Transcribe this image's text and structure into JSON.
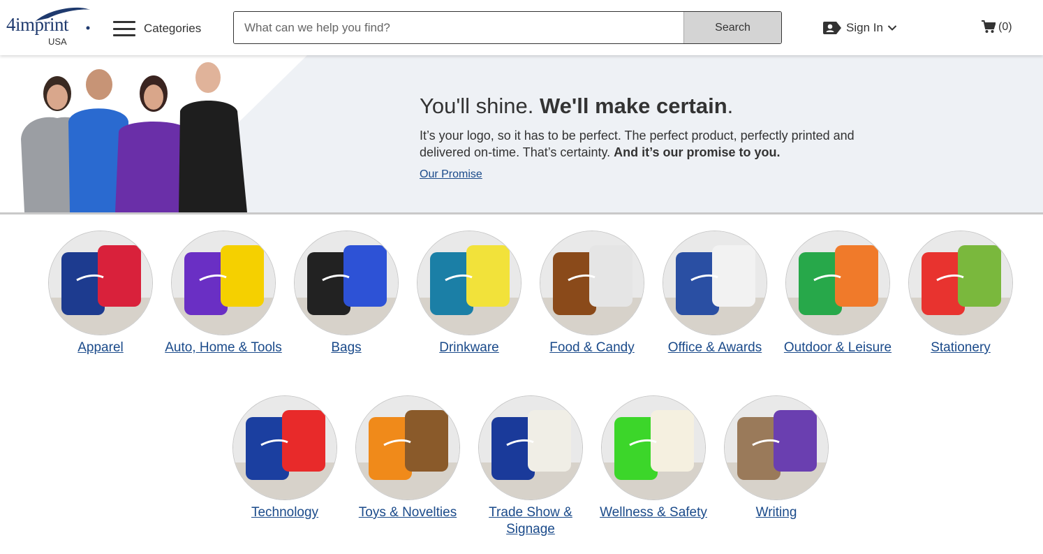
{
  "header": {
    "logo_text": "4imprint",
    "logo_region": "USA",
    "menu_label": "Categories",
    "search_placeholder": "What can we help you find?",
    "search_value": "",
    "search_button": "Search",
    "signin_label": "Sign In",
    "cart_count": "(0)"
  },
  "hero": {
    "title_light": "You'll shine. ",
    "title_bold": "We'll make certain",
    "title_end": ".",
    "body_regular": "It’s your logo, so it has to be perfect. The perfect product, perfectly printed and delivered on-time. That’s certainty. ",
    "body_bold": "And it’s our promise to you.",
    "link": "Our Promise"
  },
  "categories": [
    {
      "label": "Apparel",
      "icon": "apparel-image",
      "colors": [
        "#1d3b8f",
        "#d9213b"
      ]
    },
    {
      "label": "Auto, Home & Tools",
      "icon": "tools-image",
      "colors": [
        "#6a2fc4",
        "#f5d000"
      ]
    },
    {
      "label": "Bags",
      "icon": "bags-image",
      "colors": [
        "#222222",
        "#2d52d6"
      ]
    },
    {
      "label": "Drinkware",
      "icon": "drinkware-image",
      "colors": [
        "#1b7fa6",
        "#f2e23a"
      ]
    },
    {
      "label": "Food & Candy",
      "icon": "candy-image",
      "colors": [
        "#8a4a1a",
        "#e5e5e5"
      ]
    },
    {
      "label": "Office & Awards",
      "icon": "awards-image",
      "colors": [
        "#2a4fa3",
        "#f2f2f2"
      ]
    },
    {
      "label": "Outdoor & Leisure",
      "icon": "outdoor-image",
      "colors": [
        "#27a84a",
        "#f07a2a"
      ]
    },
    {
      "label": "Stationery",
      "icon": "stationery-image",
      "colors": [
        "#e8332f",
        "#7ab83d"
      ]
    },
    {
      "label": "Technology",
      "icon": "technology-image",
      "colors": [
        "#1b3fa0",
        "#e82a2a"
      ]
    },
    {
      "label": "Toys & Novelties",
      "icon": "toys-image",
      "colors": [
        "#f08a1a",
        "#8a5a2a"
      ]
    },
    {
      "label": "Trade Show & Signage",
      "icon": "tradeshow-image",
      "colors": [
        "#1a3a9a",
        "#f0eee6"
      ]
    },
    {
      "label": "Wellness & Safety",
      "icon": "wellness-image",
      "colors": [
        "#3cd62a",
        "#f5f0e0"
      ]
    },
    {
      "label": "Writing",
      "icon": "writing-image",
      "colors": [
        "#9a7a5a",
        "#6a3fb0"
      ]
    }
  ]
}
